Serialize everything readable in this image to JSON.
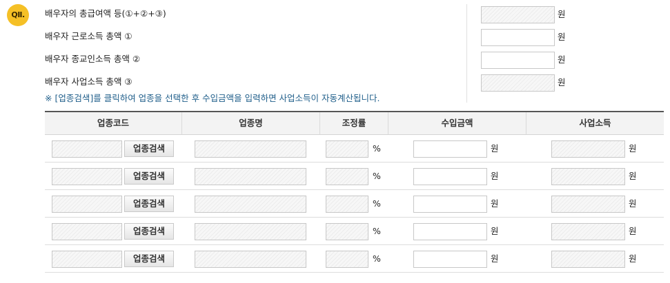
{
  "section": {
    "badge": "QⅡ.",
    "rows": [
      {
        "label": "배우자의 총급여액 등(①+②+③)",
        "unit": "원"
      },
      {
        "label": "배우자 근로소득 총액 ①",
        "unit": "원"
      },
      {
        "label": "배우자 종교인소득 총액 ②",
        "unit": "원"
      },
      {
        "label": "배우자 사업소득 총액 ③",
        "unit": "원"
      }
    ],
    "notice_mark": "※",
    "notice": "[업종검색]를 클릭하여 업종을 선택한 후 수입금액을 입력하면 사업소득이 자동계산됩니다."
  },
  "table": {
    "headers": [
      "업종코드",
      "업종명",
      "조정률",
      "수입금액",
      "사업소득"
    ],
    "search_label": "업종검색",
    "percent": "%",
    "won": "원",
    "rows": [
      {
        "code": "",
        "name": "",
        "rate": "",
        "revenue": "",
        "income": ""
      },
      {
        "code": "",
        "name": "",
        "rate": "",
        "revenue": "",
        "income": ""
      },
      {
        "code": "",
        "name": "",
        "rate": "",
        "revenue": "",
        "income": ""
      },
      {
        "code": "",
        "name": "",
        "rate": "",
        "revenue": "",
        "income": ""
      },
      {
        "code": "",
        "name": "",
        "rate": "",
        "revenue": "",
        "income": ""
      }
    ]
  }
}
